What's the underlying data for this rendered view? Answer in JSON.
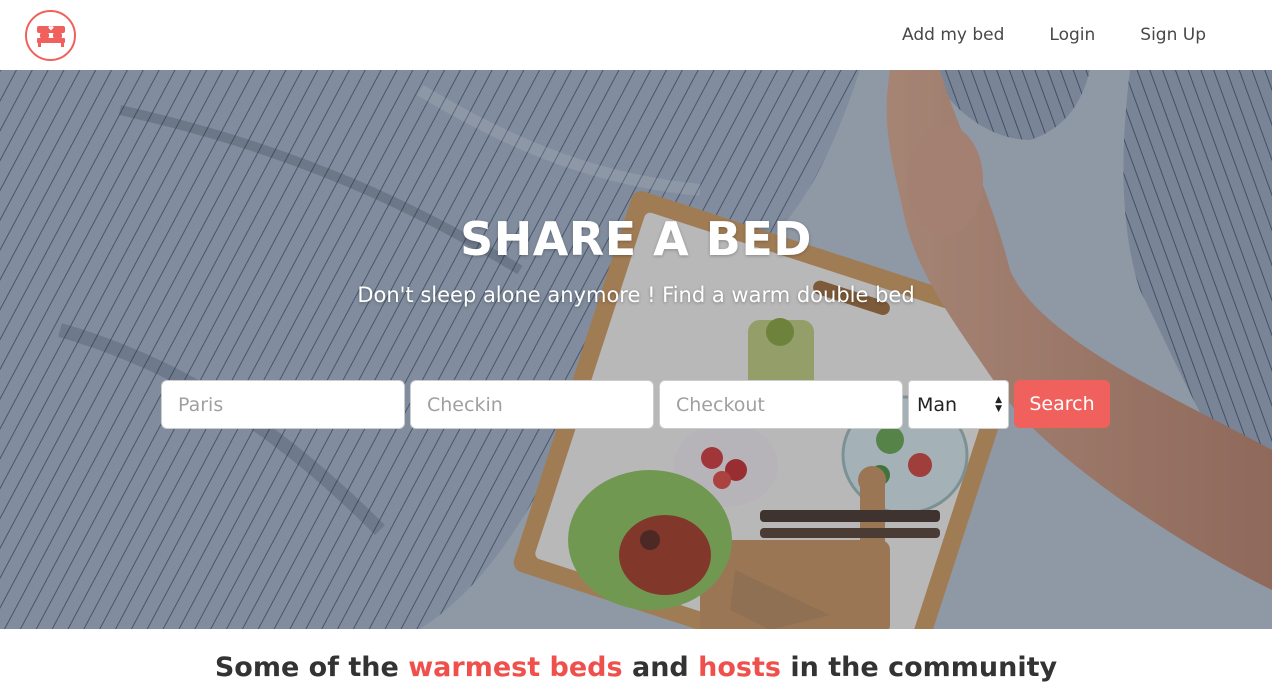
{
  "brand": {
    "logo_icon": "bed-icon",
    "accent_color": "#f0605c"
  },
  "nav": {
    "links": [
      {
        "label": "Add my bed"
      },
      {
        "label": "Login"
      },
      {
        "label": "Sign Up"
      }
    ]
  },
  "hero": {
    "title": "SHARE A BED",
    "subtitle": "Don't sleep alone anymore ! Find a warm double bed"
  },
  "search": {
    "city_placeholder": "Paris",
    "checkin_placeholder": "Checkin",
    "checkout_placeholder": "Checkout",
    "gender_selected": "Man",
    "button_label": "Search"
  },
  "section": {
    "heading_parts": [
      "Some of the ",
      "warmest beds",
      " and ",
      "hosts",
      " in the community"
    ]
  }
}
